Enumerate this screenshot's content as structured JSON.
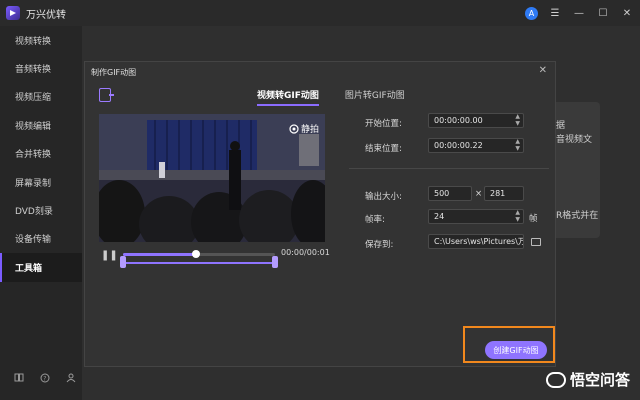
{
  "app": {
    "title": "万兴优转"
  },
  "window": {
    "avatar_letter": "A",
    "icons": [
      "user-avatar-icon",
      "menu-icon",
      "minimize-icon",
      "maximize-icon",
      "close-icon"
    ]
  },
  "sidebar": {
    "items": [
      {
        "label": "视频转换",
        "active": false
      },
      {
        "label": "音频转换",
        "active": false
      },
      {
        "label": "视频压缩",
        "active": false
      },
      {
        "label": "视频编辑",
        "active": false
      },
      {
        "label": "合并转换",
        "active": false
      },
      {
        "label": "屏幕录制",
        "active": false
      },
      {
        "label": "DVD刻录",
        "active": false
      },
      {
        "label": "设备传输",
        "active": false
      },
      {
        "label": "工具箱",
        "active": true
      }
    ],
    "footer_icons": [
      "book-icon",
      "help-icon",
      "users-icon"
    ]
  },
  "background": {
    "card1_text_a": "据",
    "card1_text_b": "音视频文",
    "card2_text": "R格式并在"
  },
  "modal": {
    "title": "制作GIF动图",
    "tabs": [
      {
        "label": "视频转GIF动图",
        "active": true
      },
      {
        "label": "图片转GIF动图",
        "active": false
      }
    ],
    "snapshot_label": "静拍",
    "timecode": "00:00/00:01",
    "progress": 0.48,
    "start_label": "开始位置:",
    "start_value": "00:00:00.00",
    "end_label": "结束位置:",
    "end_value": "00:00:00.22",
    "size_label": "输出大小:",
    "width_value": "500",
    "times": "×",
    "height_value": "281",
    "fps_label": "帧率:",
    "fps_value": "24",
    "fps_unit": "帧",
    "save_label": "保存到:",
    "save_path": "C:\\Users\\ws\\Pictures\\万",
    "create_button": "创建GIF动图"
  },
  "watermark": {
    "text": "悟空问答"
  },
  "colors": {
    "accent": "#8f74ff",
    "highlight": "#f2881d",
    "avatar": "#2f7bf5"
  }
}
